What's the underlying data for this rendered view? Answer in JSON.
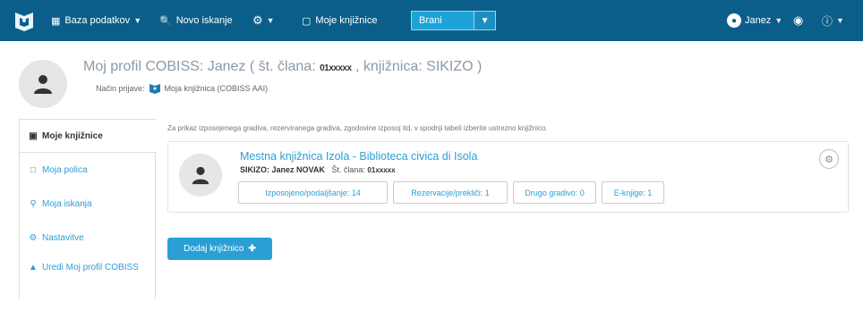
{
  "navbar": {
    "database_label": "Baza podatkov",
    "search_label": "Novo iskanje",
    "my_libraries_label": "Moje knjižnice",
    "select_value": "Brani",
    "user_label": "Janez"
  },
  "header": {
    "title_prefix": "Moj profil COBISS: Janez ( št. člana:",
    "member_masked": "01xxxxx",
    "title_suffix": ", knjižnica: SIKIZO )",
    "login_label": "Način prijave:",
    "login_value": "Moja knjižnica (COBISS AAI)"
  },
  "sidebar": {
    "items": [
      {
        "label": "Moje knjižnice",
        "icon": "library-icon"
      },
      {
        "label": "Moja polica",
        "icon": "bookmark-icon"
      },
      {
        "label": "Moja iskanja",
        "icon": "search-icon"
      },
      {
        "label": "Nastavitve",
        "icon": "cogs-icon"
      },
      {
        "label": "Uredi Moj profil COBISS",
        "icon": "user-icon"
      }
    ]
  },
  "main": {
    "info": "Za prikaz izposojenega gradiva, rezerviranega gradiva, zgodovine izposoj itd. v spodnji tabeli izberite ustrezno knjižnico.",
    "library": {
      "name": "Mestna knjižnica Izola - Biblioteca civica di Isola",
      "user_prefix": "SIKIZO: Janez NOVAK",
      "member_label": "Št. člana:",
      "member_masked": "01xxxxx",
      "stats": [
        "Izposojeno/podaljšanje: 14",
        "Rezervacije/prekliči: 1",
        "Drugo gradivo: 0",
        "E-knjige: 1"
      ]
    },
    "add_button": "Dodaj knjižnico"
  },
  "colors": {
    "navbar": "#0b5e8a",
    "accent": "#2a9fd6",
    "select": "#1ea3d9"
  }
}
